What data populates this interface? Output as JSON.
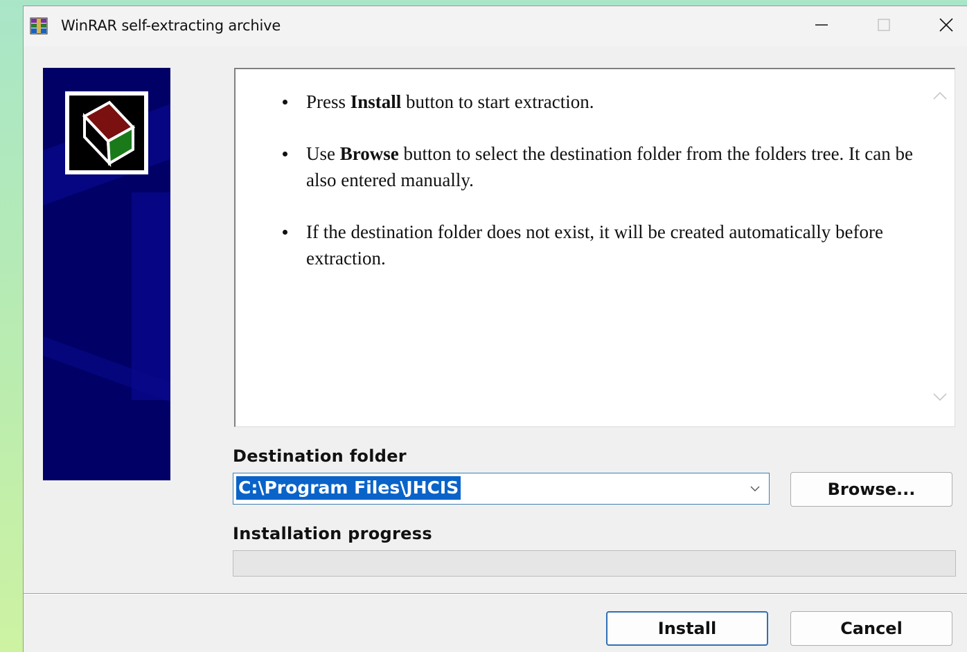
{
  "window": {
    "title": "WinRAR self-extracting archive",
    "app_icon": "winrar-icon",
    "controls": {
      "minimize": "minimize-icon",
      "maximize": "maximize-icon",
      "close": "close-icon"
    }
  },
  "banner": {
    "logo": "archive-box-icon",
    "background_color": "#000066"
  },
  "info": {
    "items": [
      {
        "pre": "Press ",
        "bold": "Install",
        "post": " button to start extraction."
      },
      {
        "pre": "Use ",
        "bold": "Browse",
        "post": " button to select the destination folder from the folders tree. It can be also entered manually."
      },
      {
        "pre": "",
        "bold": "",
        "post": "If the destination folder does not exist, it will be created automatically before extraction."
      }
    ]
  },
  "destination": {
    "label": "Destination folder",
    "value": "C:\\Program Files\\JHCIS",
    "browse_label": "Browse..."
  },
  "progress": {
    "label": "Installation progress",
    "value": 0
  },
  "buttons": {
    "install": "Install",
    "cancel": "Cancel"
  },
  "colors": {
    "selection": "#0a63c9",
    "focus_border": "#2f6fb5"
  }
}
